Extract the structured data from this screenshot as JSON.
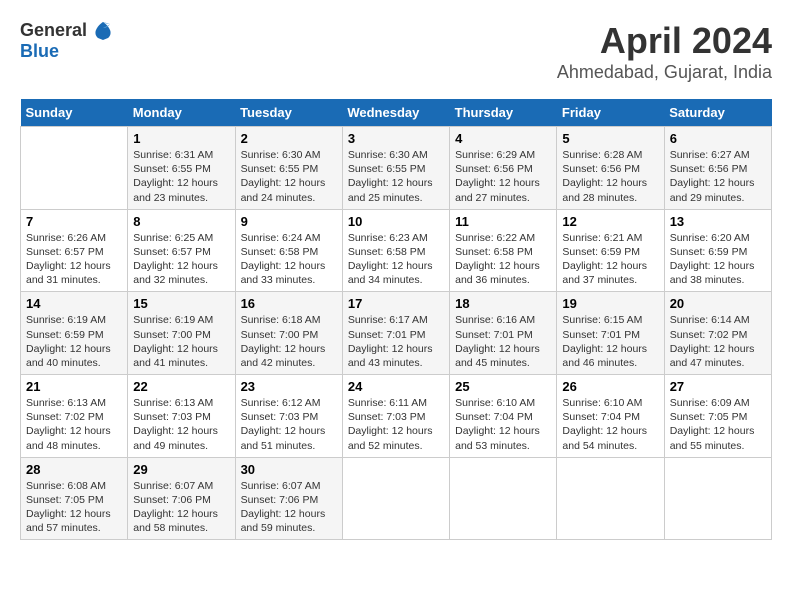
{
  "logo": {
    "line1": "General",
    "line2": "Blue"
  },
  "title": "April 2024",
  "subtitle": "Ahmedabad, Gujarat, India",
  "days_of_week": [
    "Sunday",
    "Monday",
    "Tuesday",
    "Wednesday",
    "Thursday",
    "Friday",
    "Saturday"
  ],
  "weeks": [
    [
      {
        "day": "",
        "sunrise": "",
        "sunset": "",
        "daylight": ""
      },
      {
        "day": "1",
        "sunrise": "Sunrise: 6:31 AM",
        "sunset": "Sunset: 6:55 PM",
        "daylight": "Daylight: 12 hours and 23 minutes."
      },
      {
        "day": "2",
        "sunrise": "Sunrise: 6:30 AM",
        "sunset": "Sunset: 6:55 PM",
        "daylight": "Daylight: 12 hours and 24 minutes."
      },
      {
        "day": "3",
        "sunrise": "Sunrise: 6:30 AM",
        "sunset": "Sunset: 6:55 PM",
        "daylight": "Daylight: 12 hours and 25 minutes."
      },
      {
        "day": "4",
        "sunrise": "Sunrise: 6:29 AM",
        "sunset": "Sunset: 6:56 PM",
        "daylight": "Daylight: 12 hours and 27 minutes."
      },
      {
        "day": "5",
        "sunrise": "Sunrise: 6:28 AM",
        "sunset": "Sunset: 6:56 PM",
        "daylight": "Daylight: 12 hours and 28 minutes."
      },
      {
        "day": "6",
        "sunrise": "Sunrise: 6:27 AM",
        "sunset": "Sunset: 6:56 PM",
        "daylight": "Daylight: 12 hours and 29 minutes."
      }
    ],
    [
      {
        "day": "7",
        "sunrise": "Sunrise: 6:26 AM",
        "sunset": "Sunset: 6:57 PM",
        "daylight": "Daylight: 12 hours and 31 minutes."
      },
      {
        "day": "8",
        "sunrise": "Sunrise: 6:25 AM",
        "sunset": "Sunset: 6:57 PM",
        "daylight": "Daylight: 12 hours and 32 minutes."
      },
      {
        "day": "9",
        "sunrise": "Sunrise: 6:24 AM",
        "sunset": "Sunset: 6:58 PM",
        "daylight": "Daylight: 12 hours and 33 minutes."
      },
      {
        "day": "10",
        "sunrise": "Sunrise: 6:23 AM",
        "sunset": "Sunset: 6:58 PM",
        "daylight": "Daylight: 12 hours and 34 minutes."
      },
      {
        "day": "11",
        "sunrise": "Sunrise: 6:22 AM",
        "sunset": "Sunset: 6:58 PM",
        "daylight": "Daylight: 12 hours and 36 minutes."
      },
      {
        "day": "12",
        "sunrise": "Sunrise: 6:21 AM",
        "sunset": "Sunset: 6:59 PM",
        "daylight": "Daylight: 12 hours and 37 minutes."
      },
      {
        "day": "13",
        "sunrise": "Sunrise: 6:20 AM",
        "sunset": "Sunset: 6:59 PM",
        "daylight": "Daylight: 12 hours and 38 minutes."
      }
    ],
    [
      {
        "day": "14",
        "sunrise": "Sunrise: 6:19 AM",
        "sunset": "Sunset: 6:59 PM",
        "daylight": "Daylight: 12 hours and 40 minutes."
      },
      {
        "day": "15",
        "sunrise": "Sunrise: 6:19 AM",
        "sunset": "Sunset: 7:00 PM",
        "daylight": "Daylight: 12 hours and 41 minutes."
      },
      {
        "day": "16",
        "sunrise": "Sunrise: 6:18 AM",
        "sunset": "Sunset: 7:00 PM",
        "daylight": "Daylight: 12 hours and 42 minutes."
      },
      {
        "day": "17",
        "sunrise": "Sunrise: 6:17 AM",
        "sunset": "Sunset: 7:01 PM",
        "daylight": "Daylight: 12 hours and 43 minutes."
      },
      {
        "day": "18",
        "sunrise": "Sunrise: 6:16 AM",
        "sunset": "Sunset: 7:01 PM",
        "daylight": "Daylight: 12 hours and 45 minutes."
      },
      {
        "day": "19",
        "sunrise": "Sunrise: 6:15 AM",
        "sunset": "Sunset: 7:01 PM",
        "daylight": "Daylight: 12 hours and 46 minutes."
      },
      {
        "day": "20",
        "sunrise": "Sunrise: 6:14 AM",
        "sunset": "Sunset: 7:02 PM",
        "daylight": "Daylight: 12 hours and 47 minutes."
      }
    ],
    [
      {
        "day": "21",
        "sunrise": "Sunrise: 6:13 AM",
        "sunset": "Sunset: 7:02 PM",
        "daylight": "Daylight: 12 hours and 48 minutes."
      },
      {
        "day": "22",
        "sunrise": "Sunrise: 6:13 AM",
        "sunset": "Sunset: 7:03 PM",
        "daylight": "Daylight: 12 hours and 49 minutes."
      },
      {
        "day": "23",
        "sunrise": "Sunrise: 6:12 AM",
        "sunset": "Sunset: 7:03 PM",
        "daylight": "Daylight: 12 hours and 51 minutes."
      },
      {
        "day": "24",
        "sunrise": "Sunrise: 6:11 AM",
        "sunset": "Sunset: 7:03 PM",
        "daylight": "Daylight: 12 hours and 52 minutes."
      },
      {
        "day": "25",
        "sunrise": "Sunrise: 6:10 AM",
        "sunset": "Sunset: 7:04 PM",
        "daylight": "Daylight: 12 hours and 53 minutes."
      },
      {
        "day": "26",
        "sunrise": "Sunrise: 6:10 AM",
        "sunset": "Sunset: 7:04 PM",
        "daylight": "Daylight: 12 hours and 54 minutes."
      },
      {
        "day": "27",
        "sunrise": "Sunrise: 6:09 AM",
        "sunset": "Sunset: 7:05 PM",
        "daylight": "Daylight: 12 hours and 55 minutes."
      }
    ],
    [
      {
        "day": "28",
        "sunrise": "Sunrise: 6:08 AM",
        "sunset": "Sunset: 7:05 PM",
        "daylight": "Daylight: 12 hours and 57 minutes."
      },
      {
        "day": "29",
        "sunrise": "Sunrise: 6:07 AM",
        "sunset": "Sunset: 7:06 PM",
        "daylight": "Daylight: 12 hours and 58 minutes."
      },
      {
        "day": "30",
        "sunrise": "Sunrise: 6:07 AM",
        "sunset": "Sunset: 7:06 PM",
        "daylight": "Daylight: 12 hours and 59 minutes."
      },
      {
        "day": "",
        "sunrise": "",
        "sunset": "",
        "daylight": ""
      },
      {
        "day": "",
        "sunrise": "",
        "sunset": "",
        "daylight": ""
      },
      {
        "day": "",
        "sunrise": "",
        "sunset": "",
        "daylight": ""
      },
      {
        "day": "",
        "sunrise": "",
        "sunset": "",
        "daylight": ""
      }
    ]
  ]
}
